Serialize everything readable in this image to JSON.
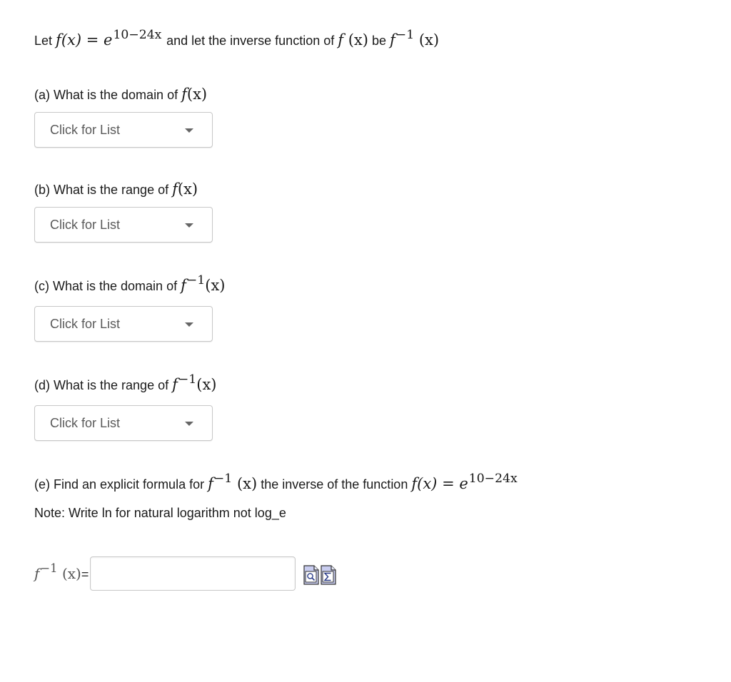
{
  "intro": {
    "prefix": "Let",
    "f_lhs": "f(x)",
    "equals": "=",
    "base": "e",
    "exponent": "10−24x",
    "middle": "and let the inverse function of",
    "f_name": "f",
    "f_arg": "(x)",
    "be": "be",
    "inv_name": "f",
    "inv_sup": "−1",
    "inv_arg": "(x)"
  },
  "questions": [
    {
      "label": "(a) What is the domain of",
      "math_name": "f",
      "math_sup": "",
      "math_arg": "(x)",
      "select_placeholder": "Click for List"
    },
    {
      "label": "(b) What is the range of",
      "math_name": "f",
      "math_sup": "",
      "math_arg": "(x)",
      "select_placeholder": "Click for List"
    },
    {
      "label": "(c) What is the domain of",
      "math_name": "f",
      "math_sup": "−1",
      "math_arg": "(x)",
      "select_placeholder": "Click for List"
    },
    {
      "label": "(d) What is the range of",
      "math_name": "f",
      "math_sup": "−1",
      "math_arg": "(x)",
      "select_placeholder": "Click for List"
    }
  ],
  "part_e": {
    "label": "(e) Find an explicit formula for",
    "inv_name": "f",
    "inv_sup": "−1",
    "inv_arg": "(x)",
    "middle": "the inverse of the function",
    "f_lhs": "f(x)",
    "equals": "=",
    "base": "e",
    "exponent": "10−24x",
    "note": "Note: Write ln for natural logarithm not log_e"
  },
  "answer": {
    "label_name": "f",
    "label_sup": "−1",
    "label_arg": "(x)",
    "label_equals": "=",
    "value": "",
    "placeholder": "",
    "icons": [
      "preview-icon",
      "equation-editor-icon"
    ]
  }
}
